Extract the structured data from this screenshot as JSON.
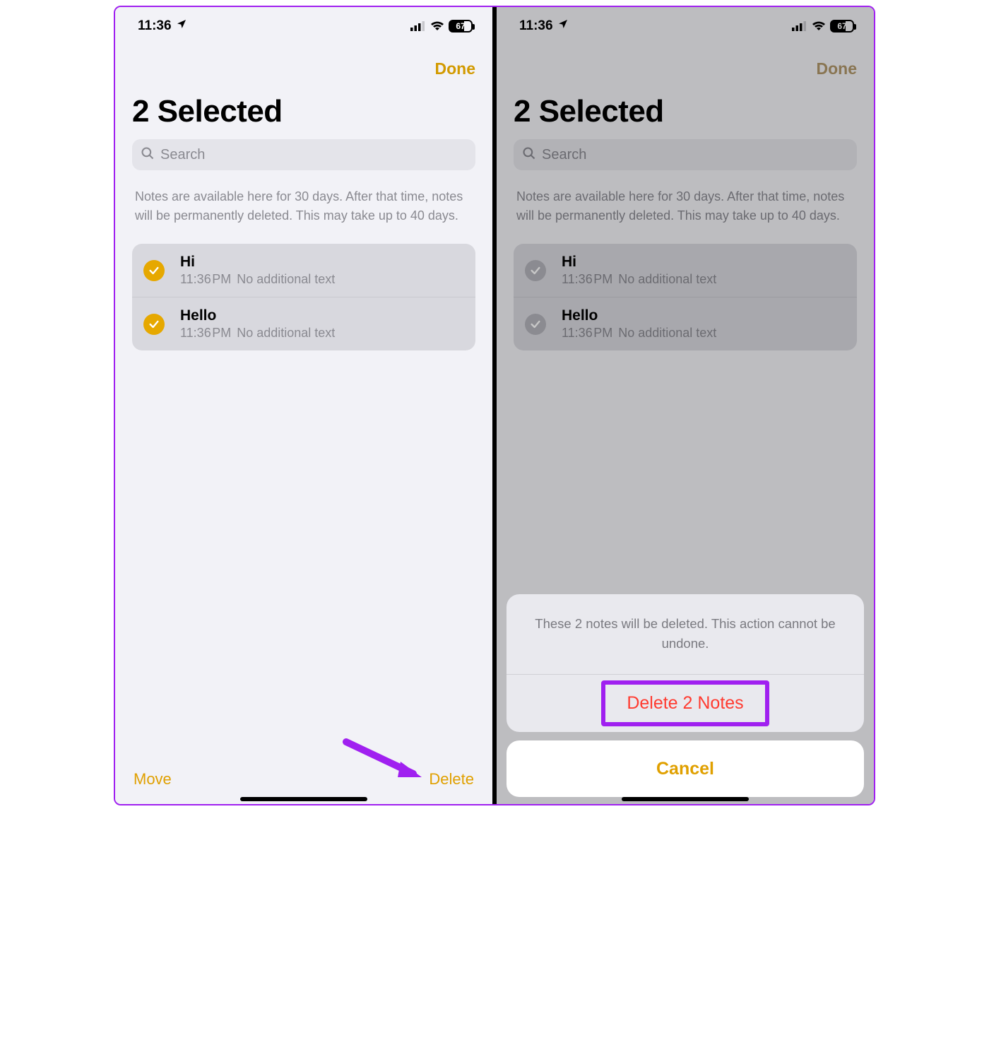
{
  "status": {
    "time": "11:36",
    "battery_pct": "67"
  },
  "header": {
    "done_label": "Done",
    "title": "2 Selected"
  },
  "search": {
    "placeholder": "Search"
  },
  "info": {
    "text": "Notes are available here for 30 days. After that time, notes will be permanently deleted. This may take up to 40 days."
  },
  "notes": [
    {
      "title": "Hi",
      "time": "11:36 PM",
      "sub": "No additional text",
      "selected": true
    },
    {
      "title": "Hello",
      "time": "11:36 PM",
      "sub": "No additional text",
      "selected": true
    }
  ],
  "toolbar": {
    "move_label": "Move",
    "delete_label": "Delete"
  },
  "sheet": {
    "message": "These 2 notes will be deleted. This action cannot be undone.",
    "delete_label": "Delete 2 Notes",
    "cancel_label": "Cancel"
  }
}
